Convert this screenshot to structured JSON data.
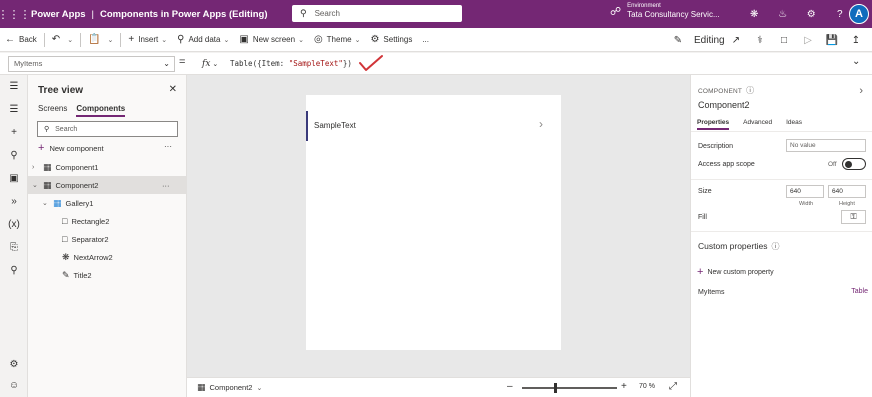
{
  "app": {
    "product": "Power Apps",
    "app_title": "Components in Power Apps (Editing)",
    "search_placeholder": "Search",
    "environment_label": "Environment",
    "environment_name": "Tata Consultancy Servic...",
    "avatar_letter": "A"
  },
  "commandbar": {
    "back": "Back",
    "insert": "Insert",
    "add_data": "Add data",
    "new_screen": "New screen",
    "theme": "Theme",
    "settings": "Settings",
    "more": "...",
    "editing": "Editing"
  },
  "formula": {
    "property": "MyItems",
    "equals": "=",
    "fx": "fx",
    "prefix": "Table({Item: ",
    "string": "\"SampleText\"",
    "suffix": "})"
  },
  "tree": {
    "title": "Tree view",
    "tabs": [
      "Screens",
      "Components"
    ],
    "active_tab": "Components",
    "search_placeholder": "Search",
    "new_component": "New component",
    "more": "···",
    "nodes": [
      "Component1",
      "Component2",
      "Gallery1",
      "Rectangle2",
      "Separator2",
      "NextArrow2",
      "Title2"
    ],
    "selected_more": "···"
  },
  "canvas": {
    "gallery_text": "SampleText"
  },
  "statusbar": {
    "component": "Component2",
    "zoom": "70 %"
  },
  "properties": {
    "kind": "COMPONENT",
    "name": "Component2",
    "tabs": [
      "Properties",
      "Advanced",
      "Ideas"
    ],
    "active_tab": "Properties",
    "description_label": "Description",
    "description_placeholder": "No value",
    "access_scope_label": "Access app scope",
    "access_scope_value": "Off",
    "size_label": "Size",
    "width_value": "640",
    "height_value": "640",
    "width_caption": "Width",
    "height_caption": "Height",
    "fill_label": "Fill",
    "custom_props_title": "Custom properties",
    "new_custom_property": "New custom property",
    "custom_prop_name": "MyItems",
    "custom_prop_type": "Table"
  },
  "colors": {
    "brand": "#742774",
    "selection_bar": "#3a3a7a",
    "checkmark": "#d13438"
  }
}
